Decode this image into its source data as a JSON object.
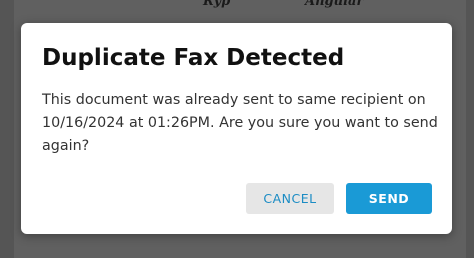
{
  "background": {
    "signature_text": "Ryp",
    "framework_text": "Angular"
  },
  "dialog": {
    "title": "Duplicate Fax Detected",
    "message": "This document was already sent to same recipient on 10/16/2024 at 01:26PM. Are you sure you want to send again?",
    "cancel_label": "CANCEL",
    "send_label": "SEND"
  },
  "colors": {
    "accent": "#1a9ad6",
    "cancel_text": "#1b8cc4",
    "overlay": "#606060"
  }
}
